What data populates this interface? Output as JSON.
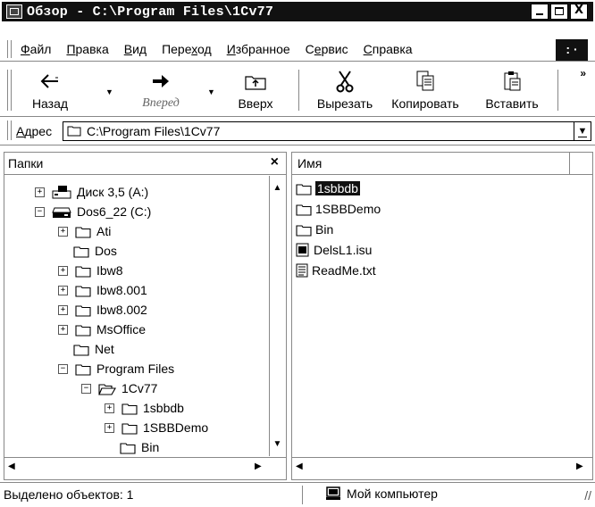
{
  "window": {
    "title": "Обзор - C:\\Program Files\\1Cv77",
    "min_label": "",
    "max_label": "",
    "close_label": "X"
  },
  "menu": {
    "items": [
      {
        "u": "Ф",
        "rest": "айл"
      },
      {
        "u": "П",
        "rest": "равка"
      },
      {
        "u": "В",
        "rest": "ид"
      },
      {
        "pre": "Пере",
        "u": "х",
        "rest": "од"
      },
      {
        "u": "И",
        "rest": "збранное"
      },
      {
        "pre": "С",
        "u": "е",
        "rest": "рвис"
      },
      {
        "u": "С",
        "rest": "правка"
      }
    ],
    "throbber": ": ·"
  },
  "toolbar": {
    "back": "Назад",
    "forward": "Вперед",
    "up": "Вверх",
    "cut": "Вырезать",
    "copy": "Копировать",
    "paste": "Вставить",
    "overflow": "»"
  },
  "address": {
    "label_u": "А",
    "label_rest": "дрес",
    "value": "C:\\Program Files\\1Cv77"
  },
  "folders_pane": {
    "title": "Папки",
    "close": "×",
    "tree": [
      {
        "label": "Диск 3,5 (A:)",
        "pm": "+",
        "icon": "floppy",
        "level": 0
      },
      {
        "label": "Dos6_22 (C:)",
        "pm": "−",
        "icon": "drive",
        "level": 0
      },
      {
        "label": "Ati",
        "pm": "+",
        "icon": "folder",
        "level": 1
      },
      {
        "label": "Dos",
        "pm": "",
        "icon": "folder",
        "level": 1
      },
      {
        "label": "Ibw8",
        "pm": "+",
        "icon": "folder",
        "level": 1
      },
      {
        "label": "Ibw8.001",
        "pm": "+",
        "icon": "folder",
        "level": 1
      },
      {
        "label": "Ibw8.002",
        "pm": "+",
        "icon": "folder",
        "level": 1
      },
      {
        "label": "MsOffice",
        "pm": "+",
        "icon": "folder",
        "level": 1
      },
      {
        "label": "Net",
        "pm": "",
        "icon": "folder",
        "level": 1
      },
      {
        "label": "Program Files",
        "pm": "−",
        "icon": "folder",
        "level": 1
      },
      {
        "label": "1Cv77",
        "pm": "−",
        "icon": "folder-open",
        "level": 2
      },
      {
        "label": "1sbbdb",
        "pm": "+",
        "icon": "folder",
        "level": 3
      },
      {
        "label": "1SBBDemo",
        "pm": "+",
        "icon": "folder",
        "level": 3
      },
      {
        "label": "Bin",
        "pm": "",
        "icon": "folder",
        "level": 3
      }
    ]
  },
  "files_pane": {
    "column_name": "Имя",
    "files": [
      {
        "name": "1sbbdb",
        "icon": "folder",
        "selected": true
      },
      {
        "name": "1SBBDemo",
        "icon": "folder",
        "selected": false
      },
      {
        "name": "Bin",
        "icon": "folder",
        "selected": false
      },
      {
        "name": "DelsL1.isu",
        "icon": "setup-file",
        "selected": false
      },
      {
        "name": "ReadMe.txt",
        "icon": "text-file",
        "selected": false
      }
    ]
  },
  "status": {
    "selected": "Выделено объектов: 1",
    "location": "Мой компьютер"
  }
}
